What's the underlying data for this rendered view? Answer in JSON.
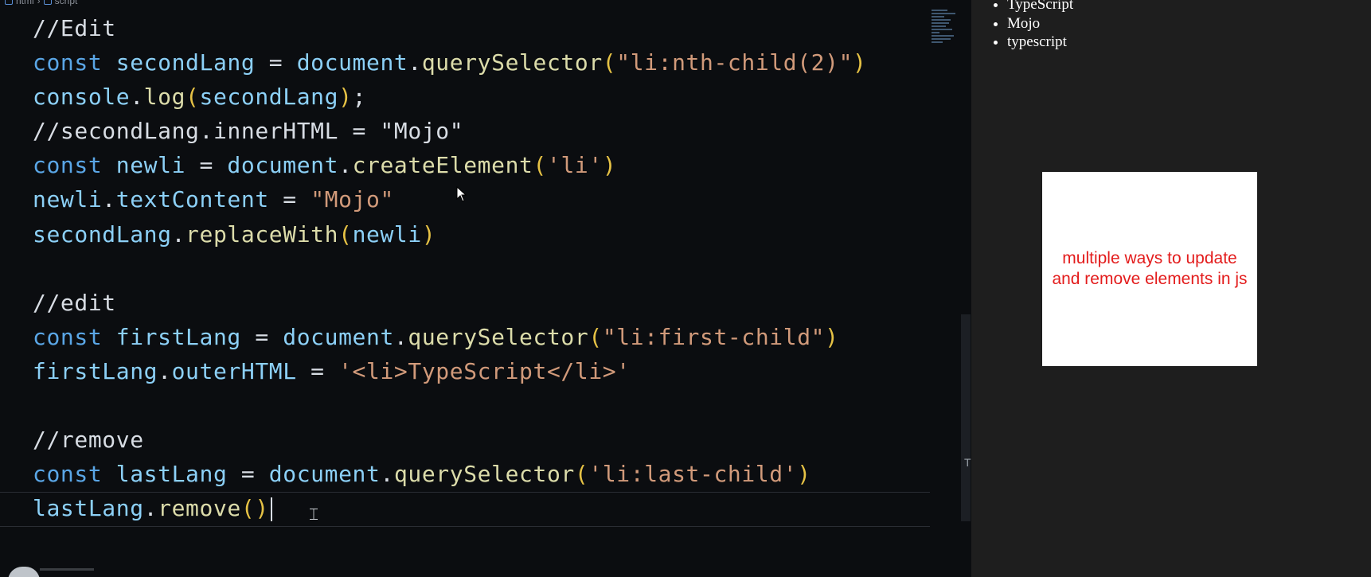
{
  "breadcrumb": {
    "items": [
      "html",
      "script"
    ]
  },
  "code_lines": [
    [
      {
        "t": "cmt",
        "v": "//Edit"
      }
    ],
    [
      {
        "t": "kw",
        "v": "const "
      },
      {
        "t": "var",
        "v": "secondLang"
      },
      {
        "t": "plain",
        "v": " = "
      },
      {
        "t": "var",
        "v": "document"
      },
      {
        "t": "plain",
        "v": "."
      },
      {
        "t": "fn",
        "v": "querySelector"
      },
      {
        "t": "brk",
        "v": "("
      },
      {
        "t": "str",
        "v": "\"li:nth-child(2)\""
      },
      {
        "t": "brk",
        "v": ")"
      }
    ],
    [
      {
        "t": "var",
        "v": "console"
      },
      {
        "t": "plain",
        "v": "."
      },
      {
        "t": "fn",
        "v": "log"
      },
      {
        "t": "brk",
        "v": "("
      },
      {
        "t": "var",
        "v": "secondLang"
      },
      {
        "t": "brk",
        "v": ")"
      },
      {
        "t": "plain",
        "v": ";"
      }
    ],
    [
      {
        "t": "cmt",
        "v": "//secondLang.innerHTML = \"Mojo\""
      }
    ],
    [
      {
        "t": "kw",
        "v": "const "
      },
      {
        "t": "var",
        "v": "newli"
      },
      {
        "t": "plain",
        "v": " = "
      },
      {
        "t": "var",
        "v": "document"
      },
      {
        "t": "plain",
        "v": "."
      },
      {
        "t": "fn",
        "v": "createElement"
      },
      {
        "t": "brk",
        "v": "("
      },
      {
        "t": "str",
        "v": "'li'"
      },
      {
        "t": "brk",
        "v": ")"
      }
    ],
    [
      {
        "t": "var",
        "v": "newli"
      },
      {
        "t": "plain",
        "v": "."
      },
      {
        "t": "var",
        "v": "textContent"
      },
      {
        "t": "plain",
        "v": " = "
      },
      {
        "t": "str",
        "v": "\"Mojo\""
      }
    ],
    [
      {
        "t": "var",
        "v": "secondLang"
      },
      {
        "t": "plain",
        "v": "."
      },
      {
        "t": "fn",
        "v": "replaceWith"
      },
      {
        "t": "brk",
        "v": "("
      },
      {
        "t": "var",
        "v": "newli"
      },
      {
        "t": "brk",
        "v": ")"
      }
    ],
    [],
    [
      {
        "t": "cmt",
        "v": "//edit"
      }
    ],
    [
      {
        "t": "kw",
        "v": "const "
      },
      {
        "t": "var",
        "v": "firstLang"
      },
      {
        "t": "plain",
        "v": " = "
      },
      {
        "t": "var",
        "v": "document"
      },
      {
        "t": "plain",
        "v": "."
      },
      {
        "t": "fn",
        "v": "querySelector"
      },
      {
        "t": "brk",
        "v": "("
      },
      {
        "t": "str",
        "v": "\"li:first-child\""
      },
      {
        "t": "brk",
        "v": ")"
      }
    ],
    [
      {
        "t": "var",
        "v": "firstLang"
      },
      {
        "t": "plain",
        "v": "."
      },
      {
        "t": "var",
        "v": "outerHTML"
      },
      {
        "t": "plain",
        "v": " = "
      },
      {
        "t": "str",
        "v": "'<li>TypeScript</li>'"
      }
    ],
    [],
    [
      {
        "t": "cmt",
        "v": "//remove"
      }
    ],
    [
      {
        "t": "kw",
        "v": "const "
      },
      {
        "t": "var",
        "v": "lastLang"
      },
      {
        "t": "plain",
        "v": " = "
      },
      {
        "t": "var",
        "v": "document"
      },
      {
        "t": "plain",
        "v": "."
      },
      {
        "t": "fn",
        "v": "querySelector"
      },
      {
        "t": "brk",
        "v": "("
      },
      {
        "t": "str",
        "v": "'li:last-child'"
      },
      {
        "t": "brk",
        "v": ")"
      }
    ],
    [
      {
        "t": "var",
        "v": "lastLang"
      },
      {
        "t": "plain",
        "v": "."
      },
      {
        "t": "fn",
        "v": "remove"
      },
      {
        "t": "brk",
        "v": "()"
      }
    ]
  ],
  "caret_line": 14,
  "preview": {
    "list_items": [
      "TypeScript",
      "Mojo",
      "typescript"
    ],
    "card_text": "multiple ways to update and remove elements in js"
  },
  "scrollbar_mark": "T",
  "colors": {
    "editor_bg": "#0b0d10",
    "keyword": "#5aa6e6",
    "variable": "#8cd0f7",
    "function": "#dcdcaa",
    "string": "#d19a7a",
    "bracket": "#e6c245",
    "card_text": "#e31c1c",
    "preview_bg": "#1e1e1e"
  }
}
